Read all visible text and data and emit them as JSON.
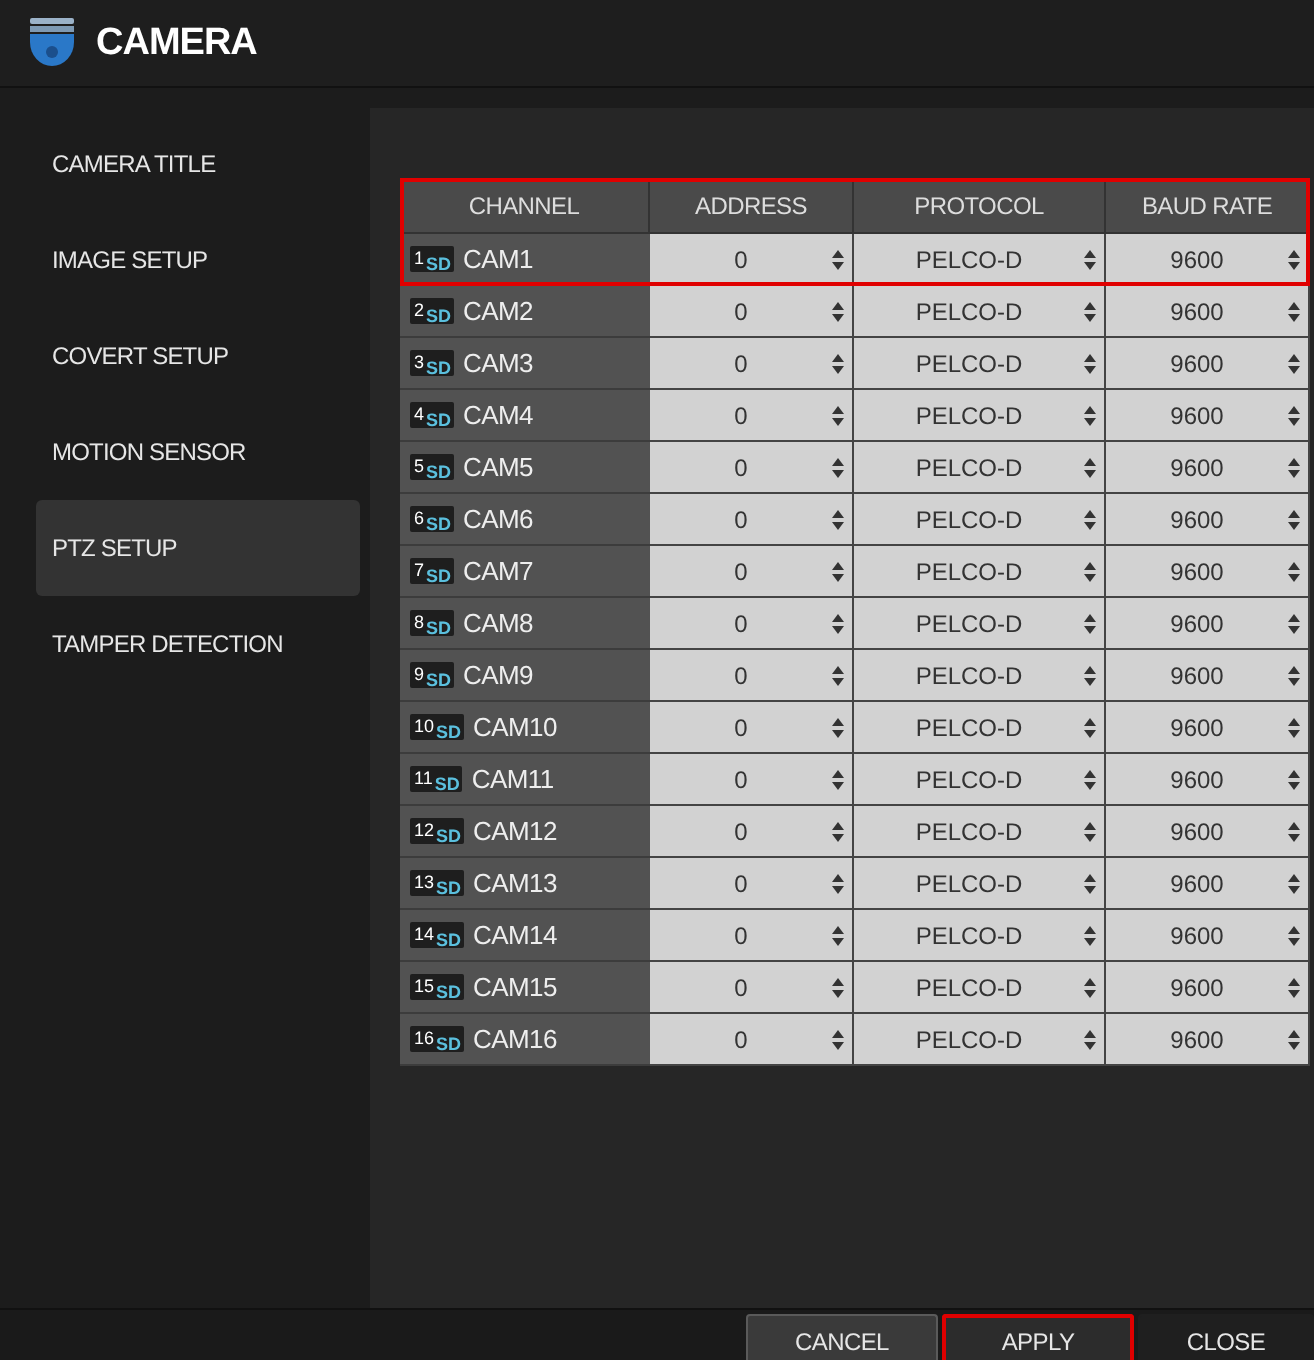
{
  "window": {
    "title": "CAMERA"
  },
  "sidebar": {
    "items": [
      {
        "label": "CAMERA TITLE",
        "selected": false
      },
      {
        "label": "IMAGE SETUP",
        "selected": false
      },
      {
        "label": "COVERT SETUP",
        "selected": false
      },
      {
        "label": "MOTION SENSOR",
        "selected": false
      },
      {
        "label": "PTZ SETUP",
        "selected": true
      },
      {
        "label": "TAMPER DETECTION",
        "selected": false
      }
    ]
  },
  "table": {
    "header_highlighted": true,
    "columns": [
      "CHANNEL",
      "ADDRESS",
      "PROTOCOL",
      "BAUD RATE"
    ],
    "rows": [
      {
        "number": "1",
        "tag": "SD",
        "name": "CAM1",
        "address": "0",
        "protocol": "PELCO-D",
        "baud_rate": "9600",
        "highlighted": true
      },
      {
        "number": "2",
        "tag": "SD",
        "name": "CAM2",
        "address": "0",
        "protocol": "PELCO-D",
        "baud_rate": "9600",
        "highlighted": false
      },
      {
        "number": "3",
        "tag": "SD",
        "name": "CAM3",
        "address": "0",
        "protocol": "PELCO-D",
        "baud_rate": "9600",
        "highlighted": false
      },
      {
        "number": "4",
        "tag": "SD",
        "name": "CAM4",
        "address": "0",
        "protocol": "PELCO-D",
        "baud_rate": "9600",
        "highlighted": false
      },
      {
        "number": "5",
        "tag": "SD",
        "name": "CAM5",
        "address": "0",
        "protocol": "PELCO-D",
        "baud_rate": "9600",
        "highlighted": false
      },
      {
        "number": "6",
        "tag": "SD",
        "name": "CAM6",
        "address": "0",
        "protocol": "PELCO-D",
        "baud_rate": "9600",
        "highlighted": false
      },
      {
        "number": "7",
        "tag": "SD",
        "name": "CAM7",
        "address": "0",
        "protocol": "PELCO-D",
        "baud_rate": "9600",
        "highlighted": false
      },
      {
        "number": "8",
        "tag": "SD",
        "name": "CAM8",
        "address": "0",
        "protocol": "PELCO-D",
        "baud_rate": "9600",
        "highlighted": false
      },
      {
        "number": "9",
        "tag": "SD",
        "name": "CAM9",
        "address": "0",
        "protocol": "PELCO-D",
        "baud_rate": "9600",
        "highlighted": false
      },
      {
        "number": "10",
        "tag": "SD",
        "name": "CAM10",
        "address": "0",
        "protocol": "PELCO-D",
        "baud_rate": "9600",
        "highlighted": false
      },
      {
        "number": "11",
        "tag": "SD",
        "name": "CAM11",
        "address": "0",
        "protocol": "PELCO-D",
        "baud_rate": "9600",
        "highlighted": false
      },
      {
        "number": "12",
        "tag": "SD",
        "name": "CAM12",
        "address": "0",
        "protocol": "PELCO-D",
        "baud_rate": "9600",
        "highlighted": false
      },
      {
        "number": "13",
        "tag": "SD",
        "name": "CAM13",
        "address": "0",
        "protocol": "PELCO-D",
        "baud_rate": "9600",
        "highlighted": false
      },
      {
        "number": "14",
        "tag": "SD",
        "name": "CAM14",
        "address": "0",
        "protocol": "PELCO-D",
        "baud_rate": "9600",
        "highlighted": false
      },
      {
        "number": "15",
        "tag": "SD",
        "name": "CAM15",
        "address": "0",
        "protocol": "PELCO-D",
        "baud_rate": "9600",
        "highlighted": false
      },
      {
        "number": "16",
        "tag": "SD",
        "name": "CAM16",
        "address": "0",
        "protocol": "PELCO-D",
        "baud_rate": "9600",
        "highlighted": false
      }
    ]
  },
  "buttons": [
    {
      "label": "CANCEL",
      "highlighted": false
    },
    {
      "label": "APPLY",
      "highlighted": true
    },
    {
      "label": "CLOSE",
      "highlighted": false
    }
  ]
}
